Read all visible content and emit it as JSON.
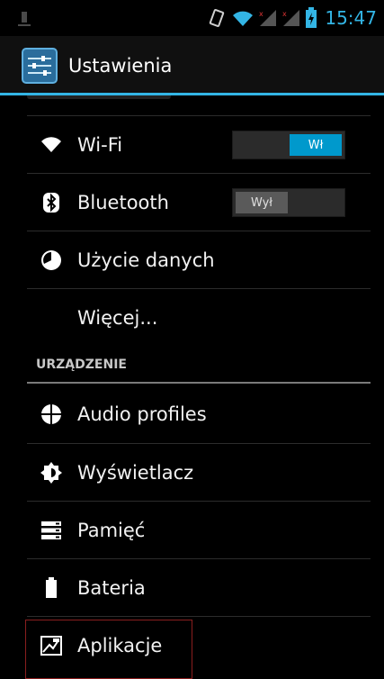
{
  "status_bar": {
    "time": "15:47",
    "icons": [
      "android-debug-icon",
      "vibrate-icon",
      "wifi-icon",
      "signal-icon",
      "signal-icon",
      "battery-charging-icon"
    ]
  },
  "action_bar": {
    "title": "Ustawienia",
    "icon": "settings-sliders-icon"
  },
  "colors": {
    "accent": "#33b5e5",
    "toggle_on": "#0099cc",
    "toggle_off": "#5a5a5a",
    "highlight_border": "#8a1e1e"
  },
  "list": {
    "items": [
      {
        "label": "Wi-Fi",
        "icon": "wifi-icon",
        "toggle": "Wł"
      },
      {
        "label": "Bluetooth",
        "icon": "bluetooth-icon",
        "toggle": "Wył"
      },
      {
        "label": "Użycie danych",
        "icon": "data-usage-icon"
      },
      {
        "label": "Więcej..."
      }
    ],
    "section_header": "URZĄDZENIE",
    "device_items": [
      {
        "label": "Audio profiles",
        "icon": "audio-profiles-icon"
      },
      {
        "label": "Wyświetlacz",
        "icon": "display-icon"
      },
      {
        "label": "Pamięć",
        "icon": "storage-icon"
      },
      {
        "label": "Bateria",
        "icon": "battery-icon"
      },
      {
        "label": "Aplikacje",
        "icon": "apps-icon"
      }
    ]
  }
}
